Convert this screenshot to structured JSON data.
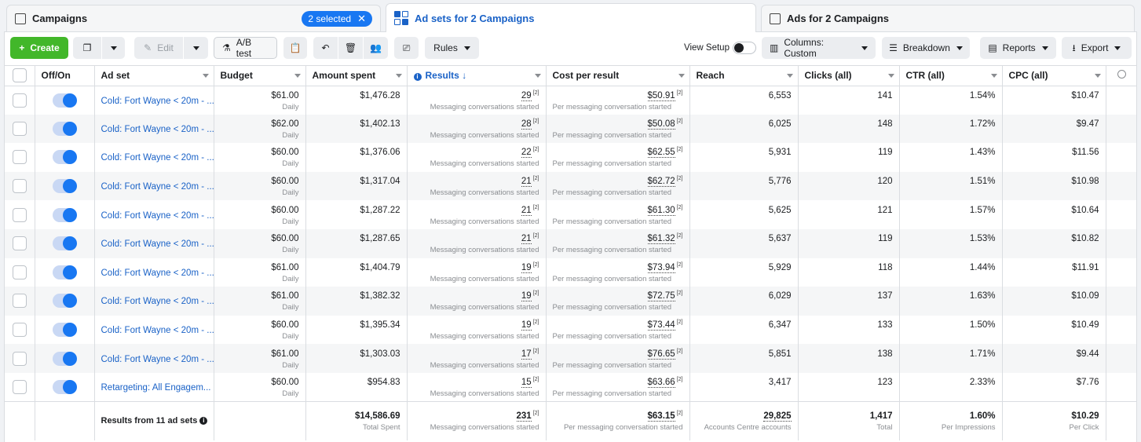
{
  "tabs": {
    "campaigns": "Campaigns",
    "selected_pill": "2 selected",
    "adsets": "Ad sets for 2 Campaigns",
    "ads": "Ads for 2 Campaigns"
  },
  "toolbar": {
    "create": "Create",
    "edit": "Edit",
    "ab_test": "A/B test",
    "rules": "Rules",
    "view_setup": "View Setup",
    "columns": "Columns: Custom",
    "breakdown": "Breakdown",
    "reports": "Reports",
    "export": "Export"
  },
  "columns": [
    "Off/On",
    "Ad set",
    "Budget",
    "Amount spent",
    "Results",
    "Cost per result",
    "Reach",
    "Clicks (all)",
    "CTR (all)",
    "CPC (all)"
  ],
  "rows": [
    {
      "name": "Cold: Fort Wayne < 20m - ...",
      "budget": "$61.00",
      "budget_sub": "Daily",
      "spent": "$1,476.28",
      "results": "29",
      "results_sub": "Messaging conversations started",
      "cpr": "$50.91",
      "cpr_sub": "Per messaging conversation started",
      "reach": "6,553",
      "clicks": "141",
      "ctr": "1.54%",
      "cpc": "$10.47"
    },
    {
      "name": "Cold: Fort Wayne < 20m - ...",
      "budget": "$62.00",
      "budget_sub": "Daily",
      "spent": "$1,402.13",
      "results": "28",
      "results_sub": "Messaging conversations started",
      "cpr": "$50.08",
      "cpr_sub": "Per messaging conversation started",
      "reach": "6,025",
      "clicks": "148",
      "ctr": "1.72%",
      "cpc": "$9.47"
    },
    {
      "name": "Cold: Fort Wayne < 20m - ...",
      "budget": "$60.00",
      "budget_sub": "Daily",
      "spent": "$1,376.06",
      "results": "22",
      "results_sub": "Messaging conversations started",
      "cpr": "$62.55",
      "cpr_sub": "Per messaging conversation started",
      "reach": "5,931",
      "clicks": "119",
      "ctr": "1.43%",
      "cpc": "$11.56"
    },
    {
      "name": "Cold: Fort Wayne < 20m - ...",
      "budget": "$60.00",
      "budget_sub": "Daily",
      "spent": "$1,317.04",
      "results": "21",
      "results_sub": "Messaging conversations started",
      "cpr": "$62.72",
      "cpr_sub": "Per messaging conversation started",
      "reach": "5,776",
      "clicks": "120",
      "ctr": "1.51%",
      "cpc": "$10.98"
    },
    {
      "name": "Cold: Fort Wayne < 20m - ...",
      "budget": "$60.00",
      "budget_sub": "Daily",
      "spent": "$1,287.22",
      "results": "21",
      "results_sub": "Messaging conversations started",
      "cpr": "$61.30",
      "cpr_sub": "Per messaging conversation started",
      "reach": "5,625",
      "clicks": "121",
      "ctr": "1.57%",
      "cpc": "$10.64"
    },
    {
      "name": "Cold: Fort Wayne < 20m - ...",
      "budget": "$60.00",
      "budget_sub": "Daily",
      "spent": "$1,287.65",
      "results": "21",
      "results_sub": "Messaging conversations started",
      "cpr": "$61.32",
      "cpr_sub": "Per messaging conversation started",
      "reach": "5,637",
      "clicks": "119",
      "ctr": "1.53%",
      "cpc": "$10.82"
    },
    {
      "name": "Cold: Fort Wayne < 20m - ...",
      "budget": "$61.00",
      "budget_sub": "Daily",
      "spent": "$1,404.79",
      "results": "19",
      "results_sub": "Messaging conversations started",
      "cpr": "$73.94",
      "cpr_sub": "Per messaging conversation started",
      "reach": "5,929",
      "clicks": "118",
      "ctr": "1.44%",
      "cpc": "$11.91"
    },
    {
      "name": "Cold: Fort Wayne < 20m - ...",
      "budget": "$61.00",
      "budget_sub": "Daily",
      "spent": "$1,382.32",
      "results": "19",
      "results_sub": "Messaging conversations started",
      "cpr": "$72.75",
      "cpr_sub": "Per messaging conversation started",
      "reach": "6,029",
      "clicks": "137",
      "ctr": "1.63%",
      "cpc": "$10.09"
    },
    {
      "name": "Cold: Fort Wayne < 20m - ...",
      "budget": "$60.00",
      "budget_sub": "Daily",
      "spent": "$1,395.34",
      "results": "19",
      "results_sub": "Messaging conversations started",
      "cpr": "$73.44",
      "cpr_sub": "Per messaging conversation started",
      "reach": "6,347",
      "clicks": "133",
      "ctr": "1.50%",
      "cpc": "$10.49"
    },
    {
      "name": "Cold: Fort Wayne < 20m - ...",
      "budget": "$61.00",
      "budget_sub": "Daily",
      "spent": "$1,303.03",
      "results": "17",
      "results_sub": "Messaging conversations started",
      "cpr": "$76.65",
      "cpr_sub": "Per messaging conversation started",
      "reach": "5,851",
      "clicks": "138",
      "ctr": "1.71%",
      "cpc": "$9.44"
    },
    {
      "name": "Retargeting: All Engagem...",
      "budget": "$60.00",
      "budget_sub": "Daily",
      "spent": "$954.83",
      "results": "15",
      "results_sub": "Messaging conversations started",
      "cpr": "$63.66",
      "cpr_sub": "Per messaging conversation started",
      "reach": "3,417",
      "clicks": "123",
      "ctr": "2.33%",
      "cpc": "$7.76"
    }
  ],
  "totals": {
    "label": "Results from 11 ad sets",
    "spent": "$14,586.69",
    "spent_sub": "Total Spent",
    "results": "231",
    "results_sub": "Messaging conversations started",
    "cpr": "$63.15",
    "cpr_sub": "Per messaging conversation started",
    "reach": "29,825",
    "reach_sub": "Accounts Centre accounts",
    "clicks": "1,417",
    "clicks_sub": "Total",
    "ctr": "1.60%",
    "ctr_sub": "Per Impressions",
    "cpc": "$10.29",
    "cpc_sub": "Per Click"
  },
  "ref_marker": "[2]"
}
